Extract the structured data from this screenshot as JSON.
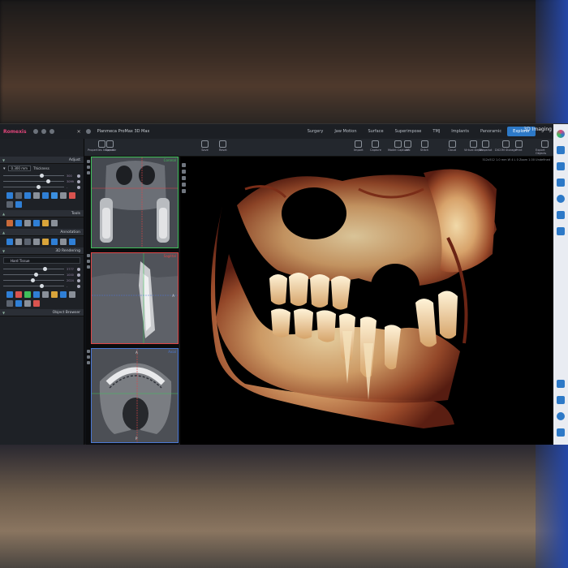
{
  "app": {
    "brand": "Romexis",
    "window_title": "Planmeca ProMax 3D Max",
    "name": "3D Imaging"
  },
  "tabs": [
    {
      "label": "Explorer",
      "active": true
    },
    {
      "label": "Panoramic",
      "active": false
    },
    {
      "label": "Implants",
      "active": false
    },
    {
      "label": "TMJ",
      "active": false
    },
    {
      "label": "Superimpose",
      "active": false
    },
    {
      "label": "Surface",
      "active": false
    },
    {
      "label": "Jaw Motion",
      "active": false
    },
    {
      "label": "Surgery",
      "active": false
    }
  ],
  "toolbar": {
    "left": [
      {
        "label": "Properties Inspector",
        "icon": "properties-icon"
      },
      {
        "label": "Export",
        "icon": "export-icon"
      },
      {
        "label": "Save",
        "icon": "save-icon"
      },
      {
        "label": "Reset",
        "icon": "reset-icon"
      }
    ],
    "right": [
      {
        "label": "Export Objects",
        "icon": "export-objects-icon"
      },
      {
        "label": "Print",
        "icon": "print-icon"
      },
      {
        "label": "DICOM Storage",
        "icon": "dicom-icon"
      },
      {
        "label": "Snapshot",
        "icon": "snapshot-icon"
      },
      {
        "label": "Virtual Depth",
        "icon": "depth-icon"
      },
      {
        "label": "Cloud",
        "icon": "cloud-icon"
      },
      {
        "label": "Stitch",
        "icon": "stitch-icon"
      },
      {
        "label": "AIN",
        "icon": "ain-icon"
      },
      {
        "label": "Model Capture",
        "icon": "model-capture-icon"
      },
      {
        "label": "Capture",
        "icon": "capture-icon"
      },
      {
        "label": "Import",
        "icon": "import-icon"
      }
    ]
  },
  "left_panel": {
    "adjust": {
      "header": "Adjust",
      "thickness_label": "Thickness",
      "thickness_value": "0.300 mm",
      "sliders": [
        {
          "label": "300",
          "level": 0.6
        },
        {
          "label": "3099",
          "level": 0.7
        },
        {
          "label": "-",
          "level": 0.55
        }
      ]
    },
    "tools_header": "Tools",
    "annotation_header": "Annotation",
    "rendering": {
      "header": "3D Rendering",
      "preset": "Hard Tissue",
      "sliders": [
        {
          "label": "3777",
          "level": 0.65
        },
        {
          "label": "1000",
          "level": 0.5
        },
        {
          "label": "2024",
          "level": 0.45
        },
        {
          "label": "-",
          "level": 0.6
        }
      ]
    },
    "object_browser_header": "Object Browser"
  },
  "views": {
    "coronal_label": "Coronal",
    "sagittal_label": "Sagittal",
    "axial_label": "Axial",
    "marker_r": "R",
    "marker_a": "A",
    "marker_p": "P"
  },
  "main_view": {
    "info": "512x512 1.0 mm  W 4 L 0  Zoom 1.00  Undefined"
  },
  "colors": {
    "accent": "#2d79c7",
    "brand": "#e0457a",
    "coronal": "#3fbf5a",
    "sagittal": "#e04646",
    "axial": "#4a78d6"
  }
}
